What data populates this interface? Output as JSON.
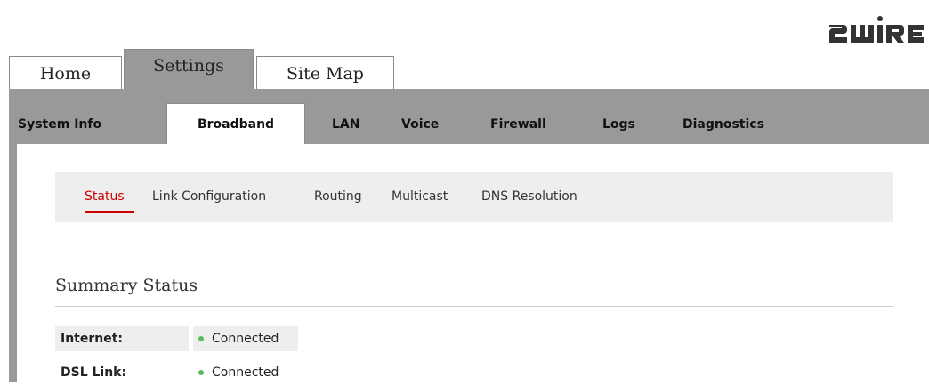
{
  "brand": {
    "logo_text": "2WIRE",
    "color": "#333333"
  },
  "top_tabs": [
    {
      "label": "Home",
      "active": false
    },
    {
      "label": "Settings",
      "active": true
    },
    {
      "label": "Site Map",
      "active": false
    }
  ],
  "sub_tabs": [
    {
      "label": "System Info",
      "active": false
    },
    {
      "label": "Broadband",
      "active": true
    },
    {
      "label": "LAN",
      "active": false
    },
    {
      "label": "Voice",
      "active": false
    },
    {
      "label": "Firewall",
      "active": false
    },
    {
      "label": "Logs",
      "active": false
    },
    {
      "label": "Diagnostics",
      "active": false
    }
  ],
  "section_nav": [
    {
      "label": "Status",
      "active": true
    },
    {
      "label": "Link Configuration",
      "active": false
    },
    {
      "label": "Routing",
      "active": false
    },
    {
      "label": "Multicast",
      "active": false
    },
    {
      "label": "DNS Resolution",
      "active": false
    }
  ],
  "summary": {
    "title": "Summary Status",
    "rows": [
      {
        "label": "Internet:",
        "value": "Connected",
        "status_color": "#5cb85c"
      },
      {
        "label": "DSL Link:",
        "value": "Connected",
        "status_color": "#5cb85c"
      }
    ]
  },
  "colors": {
    "frame_gray": "#999999",
    "accent_red": "#cc0000",
    "nav_bg": "#eeeeee"
  }
}
